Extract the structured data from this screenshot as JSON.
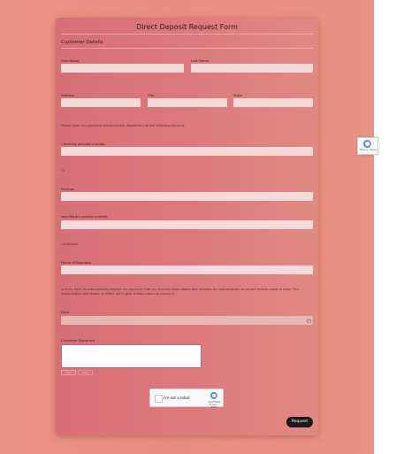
{
  "form": {
    "title": "Direct Deposit Request Form",
    "section": "Customer Details",
    "first_name_label": "First Name",
    "last_name_label": "Last Name",
    "address_label": "Address",
    "city_label": "City",
    "state_label": "State",
    "deposit_note": "Please have my paycheck automatically deposited into the following account:",
    "checking_label": "Checking account number",
    "or_text": "Or",
    "savings_label": "Savings",
    "routing_label": "Your Bank's routing number",
    "authorize_text": "I authorize",
    "bank_name_label": "Name of Business",
    "authorization_text": "and my bank to automatically deposit my paycheck into my account listed above and includes my authorization to correct entries made in error. This authorization will remain in effect until I give written notice to cancel it.",
    "date_label": "Date",
    "signature_label": "Customer Signature",
    "clear_button": "Clear",
    "undo_button": "Undo",
    "captcha_label": "I'm not a robot",
    "captcha_brand": "reCAPTCHA",
    "captcha_links": "Privacy - Terms",
    "submit_button": "Request"
  },
  "side_badge": {
    "brand_links": "Privacy - Terms"
  },
  "colors": {
    "background": "#e98e84",
    "card": "#db777b",
    "input": "#f6d9d9",
    "submit": "#1a1a1a"
  }
}
